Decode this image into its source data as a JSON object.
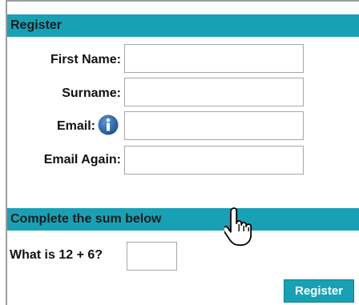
{
  "register_section": {
    "title": "Register",
    "fields": [
      {
        "label": "First Name:",
        "value": ""
      },
      {
        "label": "Surname:",
        "value": ""
      },
      {
        "label": "Email:",
        "value": ""
      },
      {
        "label": "Email Again:",
        "value": ""
      }
    ],
    "email_info_icon": "info-icon"
  },
  "sum_section": {
    "title": "Complete the sum below",
    "question": "What is 12 + 6?",
    "answer_value": ""
  },
  "register_button": {
    "label": "Register"
  },
  "colors": {
    "header_bg": "#18a1b5",
    "button_bg": "#18a1b5",
    "info_icon": "#1f5fa7"
  }
}
